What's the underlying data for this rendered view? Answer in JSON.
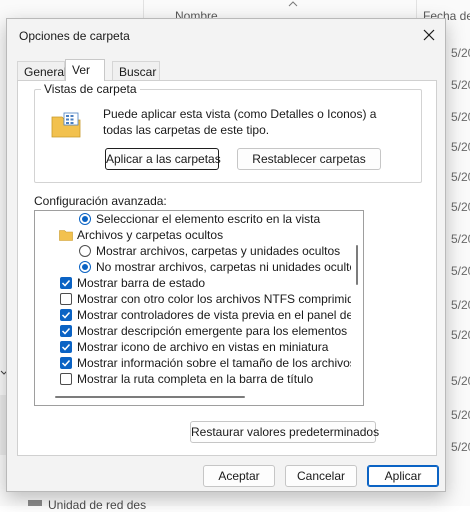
{
  "background": {
    "column_nombre": "Nombre",
    "column_fecha": "Fecha de",
    "dates": [
      "5/20",
      "5/20",
      "5/20",
      "5/20",
      "5/20",
      "5/20",
      "5/20",
      "5/20",
      "5/20",
      "5/20",
      "5/20",
      "5/20",
      "5/20"
    ],
    "bottom_item": "Unidad de red des"
  },
  "dialog": {
    "title": "Opciones de carpeta",
    "tabs": [
      {
        "label": "General"
      },
      {
        "label": "Ver"
      },
      {
        "label": "Buscar"
      }
    ],
    "folder_views": {
      "legend": "Vistas de carpeta",
      "description": "Puede aplicar esta vista (como Detalles o Iconos) a todas las carpetas de este tipo.",
      "apply_button": "Aplicar a las carpetas",
      "reset_button": "Restablecer carpetas"
    },
    "advanced_label": "Configuración avanzada:",
    "advanced_items": [
      {
        "type": "radio",
        "checked": true,
        "label": "Seleccionar el elemento escrito en la vista"
      },
      {
        "type": "folder",
        "label": "Archivos y carpetas ocultos"
      },
      {
        "type": "radio",
        "checked": false,
        "label": "Mostrar archivos, carpetas y unidades ocultos"
      },
      {
        "type": "radio",
        "checked": true,
        "label": "No mostrar archivos, carpetas ni unidades ocultos"
      },
      {
        "type": "checkbox",
        "checked": true,
        "label": "Mostrar barra de estado"
      },
      {
        "type": "checkbox",
        "checked": false,
        "label": "Mostrar con otro color los archivos NTFS comprimidos o c"
      },
      {
        "type": "checkbox",
        "checked": true,
        "label": "Mostrar controladores de vista previa en el panel de vista"
      },
      {
        "type": "checkbox",
        "checked": true,
        "label": "Mostrar descripción emergente para los elementos de car"
      },
      {
        "type": "checkbox",
        "checked": true,
        "label": "Mostrar icono de archivo en vistas en miniatura"
      },
      {
        "type": "checkbox",
        "checked": true,
        "label": "Mostrar información sobre el tamaño de los archivos en re"
      },
      {
        "type": "checkbox",
        "checked": false,
        "label": "Mostrar la ruta completa en la barra de título"
      }
    ],
    "restore_defaults_button": "Restaurar valores predeterminados",
    "ok_button": "Aceptar",
    "cancel_button": "Cancelar",
    "apply_button": "Aplicar"
  },
  "colors": {
    "accent": "#0b63c4",
    "dialog_bg": "#f3f3f3",
    "folder_yellow": "#f2c14e"
  }
}
